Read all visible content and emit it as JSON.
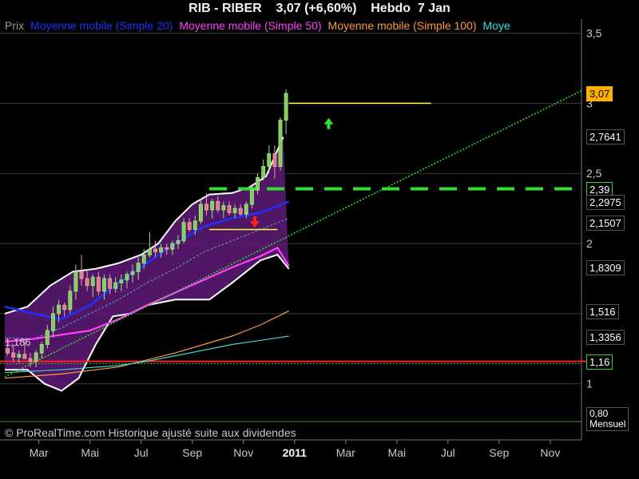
{
  "header": {
    "title": "RIB - RIBER    3,07 (+6,60%)    Hebdo  7 Jan",
    "legend": [
      {
        "label": "Prix",
        "color": "#9a9a9a"
      },
      {
        "label": "Moyenne mobile (Simple 20)",
        "color": "#2030ff"
      },
      {
        "label": "Moyenne mobile (Simple 50)",
        "color": "#ff40ff"
      },
      {
        "label": "Moyenne mobile (Simple 100)",
        "color": "#ff9a40"
      },
      {
        "label": "Moye",
        "color": "#30e0e0"
      }
    ]
  },
  "footer": {
    "credit": "© ProRealTime.com Historique ajusté suite aux dividendes",
    "bottom_tag": "0,80\nMensuel"
  },
  "price_tags": [
    {
      "text": "3,07",
      "value": 3.07,
      "style": "highlight"
    },
    {
      "text": "2,7641",
      "value": 2.7641,
      "style": "normal"
    },
    {
      "text": "2,39",
      "value": 2.39,
      "style": "green"
    },
    {
      "text": "2,2975",
      "value": 2.2975,
      "style": "normal"
    },
    {
      "text": "2,1507",
      "value": 2.1507,
      "style": "normal"
    },
    {
      "text": "1,8309",
      "value": 1.8309,
      "style": "normal"
    },
    {
      "text": "1,516",
      "value": 1.516,
      "style": "normal"
    },
    {
      "text": "1,3356",
      "value": 1.3356,
      "style": "normal"
    },
    {
      "text": "1,16",
      "value": 1.16,
      "style": "green"
    }
  ],
  "chart_data": {
    "type": "candlestick",
    "y_ticks": [
      {
        "value": 3.5,
        "label": "3,5"
      },
      {
        "value": 3.0,
        "label": "3"
      },
      {
        "value": 2.5,
        "label": "2,5"
      },
      {
        "value": 2.0,
        "label": "2"
      },
      {
        "value": 1.5,
        "label": "1,5"
      },
      {
        "value": 1.0,
        "label": "1"
      }
    ],
    "ylim": [
      0.6,
      3.6
    ],
    "x_labels": [
      {
        "label": "Mar",
        "week": 6,
        "bold": false
      },
      {
        "label": "Mai",
        "week": 15,
        "bold": false
      },
      {
        "label": "Jul",
        "week": 24,
        "bold": false
      },
      {
        "label": "Sep",
        "week": 33,
        "bold": false
      },
      {
        "label": "Nov",
        "week": 42,
        "bold": false
      },
      {
        "label": "2011",
        "week": 51,
        "bold": true
      },
      {
        "label": "Mar",
        "week": 60,
        "bold": false
      },
      {
        "label": "Mai",
        "week": 69,
        "bold": false
      },
      {
        "label": "Jul",
        "week": 78,
        "bold": false
      },
      {
        "label": "Sep",
        "week": 87,
        "bold": false
      },
      {
        "label": "Nov",
        "week": 96,
        "bold": false
      }
    ],
    "xlim": [
      0,
      101.5
    ],
    "left_label": "1,186",
    "candles": [
      [
        1.25,
        1.32,
        1.2,
        1.22
      ],
      [
        1.22,
        1.28,
        1.16,
        1.19
      ],
      [
        1.19,
        1.24,
        1.15,
        1.21
      ],
      [
        1.21,
        1.3,
        1.18,
        1.18
      ],
      [
        1.18,
        1.22,
        1.12,
        1.16
      ],
      [
        1.16,
        1.24,
        1.12,
        1.22
      ],
      [
        1.22,
        1.3,
        1.18,
        1.28
      ],
      [
        1.28,
        1.42,
        1.25,
        1.38
      ],
      [
        1.38,
        1.55,
        1.33,
        1.5
      ],
      [
        1.5,
        1.6,
        1.44,
        1.56
      ],
      [
        1.56,
        1.58,
        1.48,
        1.53
      ],
      [
        1.53,
        1.7,
        1.5,
        1.66
      ],
      [
        1.66,
        1.85,
        1.6,
        1.8
      ],
      [
        1.8,
        1.92,
        1.7,
        1.75
      ],
      [
        1.75,
        1.82,
        1.66,
        1.7
      ],
      [
        1.7,
        1.78,
        1.62,
        1.76
      ],
      [
        1.76,
        1.8,
        1.63,
        1.66
      ],
      [
        1.66,
        1.78,
        1.6,
        1.75
      ],
      [
        1.75,
        1.78,
        1.64,
        1.68
      ],
      [
        1.68,
        1.76,
        1.65,
        1.72
      ],
      [
        1.72,
        1.78,
        1.66,
        1.74
      ],
      [
        1.74,
        1.8,
        1.68,
        1.78
      ],
      [
        1.78,
        1.85,
        1.72,
        1.8
      ],
      [
        1.8,
        1.9,
        1.74,
        1.86
      ],
      [
        1.86,
        1.96,
        1.82,
        1.92
      ],
      [
        1.92,
        2.08,
        1.9,
        1.96
      ],
      [
        1.96,
        2.02,
        1.9,
        1.94
      ],
      [
        1.94,
        2.0,
        1.9,
        1.97
      ],
      [
        1.97,
        2.0,
        1.92,
        1.96
      ],
      [
        1.96,
        2.02,
        1.92,
        2.0
      ],
      [
        2.0,
        2.06,
        1.96,
        2.02
      ],
      [
        2.02,
        2.18,
        2.0,
        2.15
      ],
      [
        2.15,
        2.18,
        2.08,
        2.1
      ],
      [
        2.1,
        2.2,
        2.06,
        2.16
      ],
      [
        2.16,
        2.32,
        2.14,
        2.28
      ],
      [
        2.28,
        2.36,
        2.2,
        2.24
      ],
      [
        2.24,
        2.32,
        2.18,
        2.3
      ],
      [
        2.3,
        2.34,
        2.22,
        2.24
      ],
      [
        2.24,
        2.3,
        2.18,
        2.27
      ],
      [
        2.27,
        2.3,
        2.2,
        2.22
      ],
      [
        2.22,
        2.28,
        2.18,
        2.25
      ],
      [
        2.25,
        2.28,
        2.2,
        2.21
      ],
      [
        2.21,
        2.3,
        2.18,
        2.28
      ],
      [
        2.28,
        2.42,
        2.25,
        2.38
      ],
      [
        2.38,
        2.5,
        2.35,
        2.47
      ],
      [
        2.47,
        2.6,
        2.45,
        2.55
      ],
      [
        2.55,
        2.7,
        2.5,
        2.64
      ],
      [
        2.64,
        2.7,
        2.46,
        2.55
      ],
      [
        2.55,
        2.9,
        2.52,
        2.88
      ],
      [
        2.88,
        3.1,
        2.78,
        3.07
      ]
    ],
    "sma20": [
      [
        0,
        1.55
      ],
      [
        5,
        1.5
      ],
      [
        10,
        1.46
      ],
      [
        15,
        1.56
      ],
      [
        20,
        1.72
      ],
      [
        25,
        1.86
      ],
      [
        30,
        2.0
      ],
      [
        35,
        2.12
      ],
      [
        40,
        2.18
      ],
      [
        45,
        2.22
      ],
      [
        50,
        2.3
      ]
    ],
    "sma50": [
      [
        0,
        1.3
      ],
      [
        5,
        1.32
      ],
      [
        10,
        1.35
      ],
      [
        15,
        1.38
      ],
      [
        20,
        1.46
      ],
      [
        25,
        1.56
      ],
      [
        30,
        1.65
      ],
      [
        35,
        1.74
      ],
      [
        40,
        1.83
      ],
      [
        45,
        1.91
      ],
      [
        48,
        1.97
      ],
      [
        50,
        1.84
      ]
    ],
    "sma100": [
      [
        0,
        1.04
      ],
      [
        10,
        1.07
      ],
      [
        20,
        1.12
      ],
      [
        25,
        1.17
      ],
      [
        30,
        1.22
      ],
      [
        35,
        1.28
      ],
      [
        40,
        1.34
      ],
      [
        45,
        1.42
      ],
      [
        50,
        1.52
      ]
    ],
    "sma_cyan": [
      [
        0,
        1.08
      ],
      [
        10,
        1.1
      ],
      [
        20,
        1.13
      ],
      [
        25,
        1.16
      ],
      [
        30,
        1.2
      ],
      [
        35,
        1.24
      ],
      [
        40,
        1.28
      ],
      [
        45,
        1.31
      ],
      [
        50,
        1.34
      ]
    ],
    "bollinger_upper": [
      [
        0,
        1.5
      ],
      [
        4,
        1.55
      ],
      [
        8,
        1.7
      ],
      [
        12,
        1.8
      ],
      [
        16,
        1.82
      ],
      [
        20,
        1.86
      ],
      [
        24,
        1.92
      ],
      [
        27,
        2.0
      ],
      [
        30,
        2.16
      ],
      [
        33,
        2.28
      ],
      [
        36,
        2.35
      ],
      [
        40,
        2.36
      ],
      [
        43,
        2.4
      ],
      [
        46,
        2.48
      ],
      [
        49,
        2.76
      ]
    ],
    "bollinger_lower": [
      [
        0,
        1.1
      ],
      [
        4,
        1.1
      ],
      [
        7,
        1.0
      ],
      [
        10,
        0.95
      ],
      [
        13,
        1.04
      ],
      [
        16,
        1.28
      ],
      [
        19,
        1.48
      ],
      [
        22,
        1.5
      ],
      [
        25,
        1.56
      ],
      [
        30,
        1.6
      ],
      [
        36,
        1.6
      ],
      [
        40,
        1.72
      ],
      [
        45,
        1.88
      ],
      [
        48,
        1.92
      ],
      [
        50,
        1.82
      ]
    ],
    "bollinger_mid": [
      [
        0,
        1.33
      ],
      [
        5,
        1.32
      ],
      [
        10,
        1.4
      ],
      [
        15,
        1.5
      ],
      [
        20,
        1.6
      ],
      [
        25,
        1.72
      ],
      [
        30,
        1.82
      ],
      [
        35,
        1.94
      ],
      [
        40,
        2.02
      ],
      [
        45,
        2.1
      ],
      [
        50,
        2.18
      ]
    ],
    "support_line": {
      "value": 2.39,
      "from_week": 36
    },
    "red_line": {
      "value": 1.16
    },
    "trendline": {
      "from": [
        0,
        1.05
      ],
      "to": [
        101.5,
        3.09
      ]
    },
    "resistance_segment": {
      "value": 3.0,
      "from_week": 50,
      "to_week": 75
    },
    "yellow_segment": {
      "value": 2.1,
      "from_week": 36,
      "to_week": 48
    },
    "arrow_up": {
      "week": 57,
      "value": 2.85
    },
    "arrow_down": {
      "week": 44,
      "value": 2.16
    }
  }
}
